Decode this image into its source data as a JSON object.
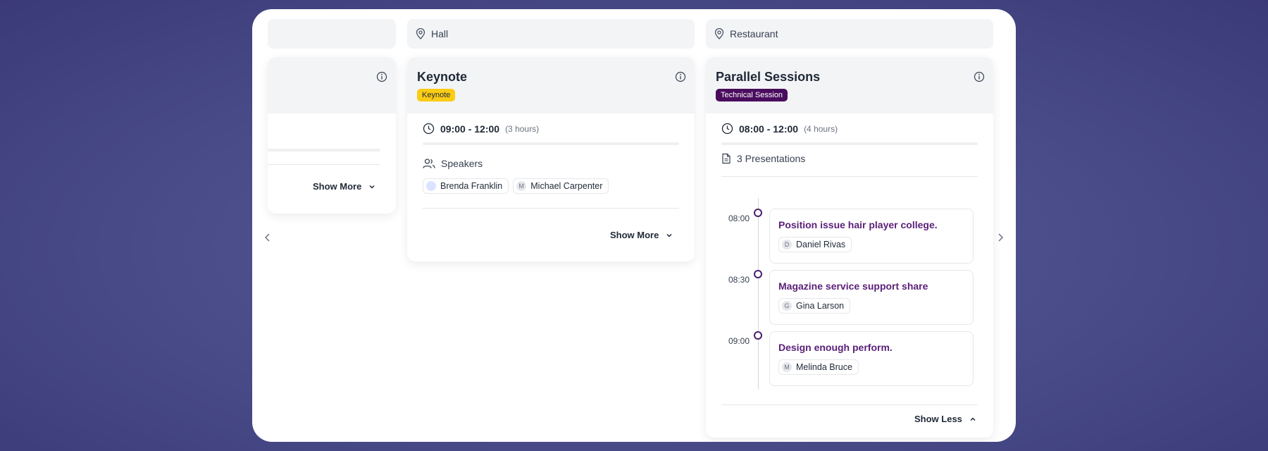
{
  "columns": {
    "left": {
      "show_more": "Show More"
    },
    "hall": {
      "location": "Hall",
      "title": "Keynote",
      "badge": "Keynote",
      "time": "09:00 - 12:00",
      "duration": "(3 hours)",
      "speakers_label": "Speakers",
      "speakers": [
        {
          "name": "Brenda Franklin",
          "initial": ""
        },
        {
          "name": "Michael Carpenter",
          "initial": "M"
        }
      ],
      "show_more": "Show More"
    },
    "restaurant": {
      "location": "Restaurant",
      "title": "Parallel Sessions",
      "badge": "Technical Session",
      "time": "08:00 - 12:00",
      "duration": "(4 hours)",
      "presentations_label": "3 Presentations",
      "presentations": [
        {
          "time": "08:00",
          "title": "Position issue hair player college.",
          "speaker": "Daniel Rivas",
          "initial": "D"
        },
        {
          "time": "08:30",
          "title": "Magazine service support share",
          "speaker": "Gina Larson",
          "initial": "G"
        },
        {
          "time": "09:00",
          "title": "Design enough perform.",
          "speaker": "Melinda Bruce",
          "initial": "M"
        }
      ],
      "show_less": "Show Less"
    }
  },
  "colors": {
    "keynote_badge": "#facc15",
    "technical_badge": "#4a0d5e",
    "presentation_title": "#5b2179"
  },
  "icons": [
    "map-pin-icon",
    "info-icon",
    "clock-icon",
    "users-icon",
    "document-icon",
    "chevron-down-icon",
    "chevron-up-icon",
    "chevron-left-icon",
    "chevron-right-icon"
  ]
}
